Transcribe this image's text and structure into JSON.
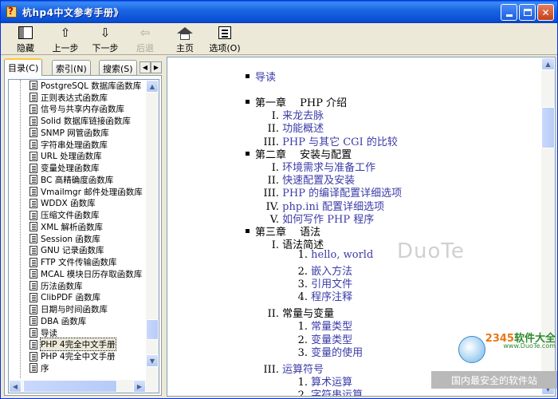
{
  "window": {
    "title": "杭hp4中文参考手册》"
  },
  "toolbar": {
    "buttons": [
      {
        "label": "隐藏",
        "icon": "hide-pane-icon",
        "enabled": true
      },
      {
        "label": "上一步",
        "icon": "arrow-up-icon",
        "enabled": true
      },
      {
        "label": "下一步",
        "icon": "arrow-down-icon",
        "enabled": true
      },
      {
        "label": "后退",
        "icon": "arrow-back-icon",
        "enabled": false
      },
      {
        "label": "主页",
        "icon": "home-icon",
        "enabled": true
      },
      {
        "label": "选项(O)",
        "icon": "options-icon",
        "enabled": true
      }
    ]
  },
  "tabs": [
    {
      "label": "目录(C)",
      "active": true
    },
    {
      "label": "索引(N)",
      "active": false
    },
    {
      "label": "搜索(S)",
      "active": false
    }
  ],
  "tree": {
    "items": [
      "PostgreSQL 数据库函数库",
      "正则表达式函数库",
      "信号与共享内存函数库",
      "Solid 数据库链接函数库",
      "SNMP 网管函数库",
      "字符串处理函数库",
      "URL 处理函数库",
      "变量处理函数库",
      "BC 高精确度函数库",
      "Vmailmgr 邮件处理函数库",
      "WDDX 函数库",
      "压缩文件函数库",
      "XML 解析函数库",
      "Session 函数库",
      "GNU 记录函数库",
      "FTP 文件传输函数库",
      "MCAL 模块日历存取函数库",
      "历法函数库",
      "ClibPDF 函数库",
      "日期与时间函数库",
      "DBA 函数库",
      "导读",
      "PHP 4完全中文手册",
      "PHP 4完全中文手册",
      "序"
    ],
    "selected_index": 22
  },
  "doc": {
    "intro": "导读",
    "chapters": [
      {
        "title": "第一章　 PHP 介绍",
        "sections": [
          {
            "num": "I.",
            "text": "来龙去脉"
          },
          {
            "num": "II.",
            "text": "功能概述"
          },
          {
            "num": "III.",
            "text": "PHP 与其它 CGI 的比较"
          }
        ]
      },
      {
        "title": "第二章　 安装与配置",
        "sections": [
          {
            "num": "I.",
            "text": "环境需求与准备工作"
          },
          {
            "num": "II.",
            "text": "快速配置及安装"
          },
          {
            "num": "III.",
            "text": "PHP 的编译配置详细选项"
          },
          {
            "num": "IV.",
            "text": "php.ini 配置详细选项"
          },
          {
            "num": "V.",
            "text": "如何写作 PHP 程序"
          }
        ]
      },
      {
        "title": "第三章　 语法",
        "subsections": [
          {
            "num": "I.",
            "title": "语法简述",
            "items": [
              "hello, world",
              "嵌入方法",
              "引用文件",
              "程序注释"
            ]
          },
          {
            "num": "II.",
            "title": "常量与变量",
            "items": [
              "常量类型",
              "变量类型",
              "变量的使用"
            ]
          },
          {
            "num": "III.",
            "title": "运算符号",
            "items": [
              "算术运算",
              "字符串运算"
            ],
            "title_is_link": true
          }
        ]
      }
    ]
  },
  "watermark": "DuoTe",
  "brand": {
    "logo_prefix": "2345",
    "logo_suffix": "软件大全",
    "url": "www.DuoTe.com",
    "strip": "国内最安全的软件站"
  }
}
